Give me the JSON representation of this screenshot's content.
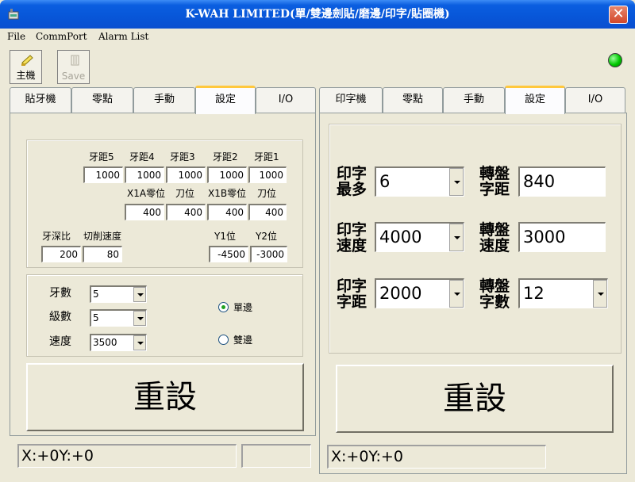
{
  "window": {
    "title": "K-WAH LIMITED(單/雙邊劍貼/磨邊/印字/貼圈機)",
    "close_glyph": "✕"
  },
  "menu": [
    "File",
    "CommPort",
    "Alarm List"
  ],
  "toolbar": {
    "main_label": "主機",
    "save_label": "Save"
  },
  "colors": {
    "led": "#00c800",
    "tab_active_accent": "#ffc83c"
  },
  "left": {
    "tabs": [
      "貼牙機",
      "零點",
      "手動",
      "設定",
      "I/O"
    ],
    "active_tab": "設定",
    "pitch_labels": [
      "牙距5",
      "牙距4",
      "牙距3",
      "牙距2",
      "牙距1"
    ],
    "pitch_values": [
      "1000",
      "1000",
      "1000",
      "1000",
      "1000"
    ],
    "pos_labels": [
      "X1A零位",
      "刀位",
      "X1B零位",
      "刀位"
    ],
    "pos_values": [
      "400",
      "400",
      "400",
      "400"
    ],
    "depth_label": "牙深比",
    "depth_value": "200",
    "speed_label": "切削速度",
    "speed_value": "80",
    "y1_label": "Y1位",
    "y1_value": "-4500",
    "y2_label": "Y2位",
    "y2_value": "-3000",
    "teeth_label": "牙數",
    "teeth_value": "5",
    "level_label": "級數",
    "level_value": "5",
    "velocity_label": "速度",
    "velocity_value": "3500",
    "radio_single": "單邊",
    "radio_double": "雙邊",
    "reset_label": "重設",
    "status": "X:+0Y:+0"
  },
  "right": {
    "tabs": [
      "印字機",
      "零點",
      "手動",
      "設定",
      "I/O"
    ],
    "active_tab": "設定",
    "print_max_label": "印字最多",
    "print_max_value": "6",
    "disk_pitch_label": "轉盤字距",
    "disk_pitch_value": "840",
    "print_speed_label": "印字速度",
    "print_speed_value": "4000",
    "disk_speed_label": "轉盤速度",
    "disk_speed_value": "3000",
    "print_pitch_label": "印字字距",
    "print_pitch_value": "2000",
    "disk_count_label": "轉盤字數",
    "disk_count_value": "12",
    "reset_label": "重設",
    "status": "X:+0Y:+0"
  }
}
